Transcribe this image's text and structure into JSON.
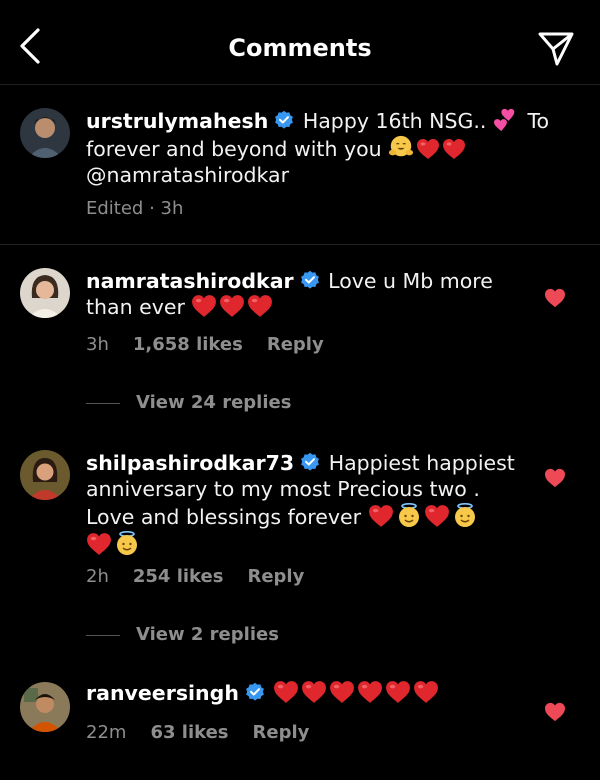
{
  "header": {
    "title": "Comments"
  },
  "caption": {
    "username": "urstrulymahesh",
    "text_line1": "Happy 16th NSG..",
    "text_line1_end": "To",
    "text_line2": "forever and beyond with you",
    "mention": "@namratashirodkar",
    "edited": "Edited",
    "time": "3h"
  },
  "comments": [
    {
      "username": "namratashirodkar",
      "text_line1": "Love u Mb more",
      "text_line2": "than ever",
      "time": "3h",
      "likes": "1,658 likes",
      "reply": "Reply",
      "view_replies": "View 24 replies"
    },
    {
      "username": "shilpashirodkar73",
      "text_line1": "Happiest happiest",
      "text_line2": "anniversary to my most Precious two .",
      "text_line3": "Love and blessings forever",
      "time": "2h",
      "likes": "254 likes",
      "reply": "Reply",
      "view_replies": "View 2 replies"
    },
    {
      "username": "ranveersingh",
      "time": "22m",
      "likes": "63 likes",
      "reply": "Reply"
    }
  ],
  "colors": {
    "background": "#000000",
    "like_heart": "#ed4956",
    "verified": "#3897f0",
    "muted": "#8e8e8e"
  }
}
